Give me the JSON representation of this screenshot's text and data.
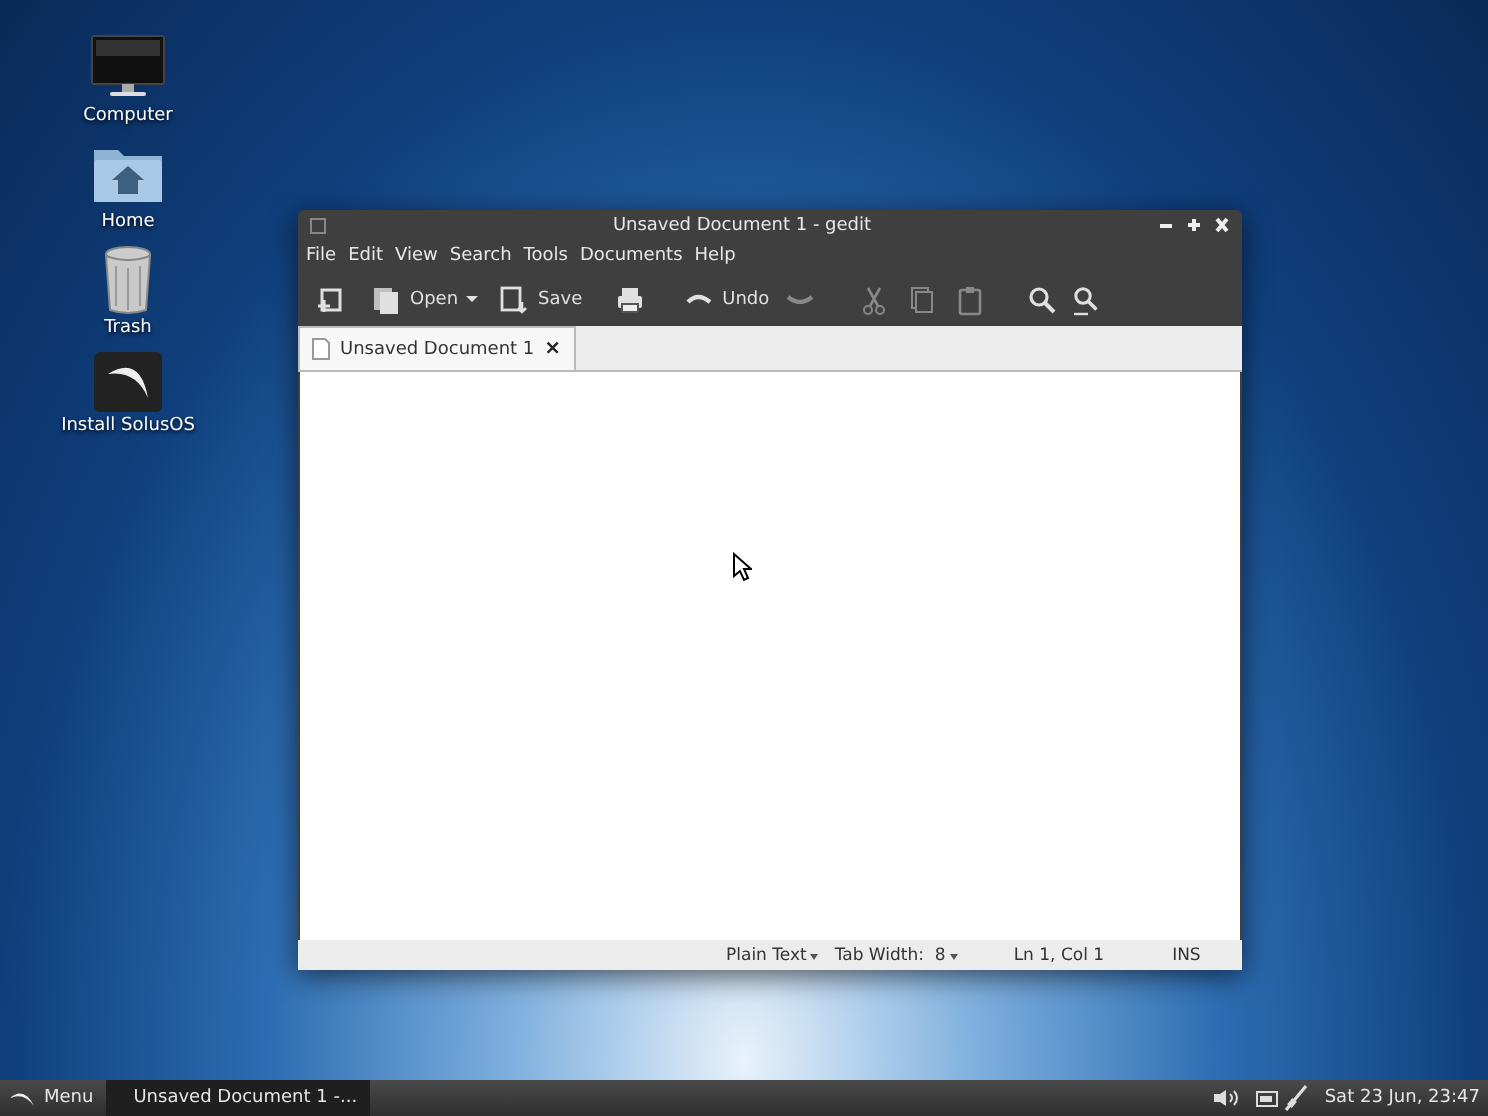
{
  "desktop_icons": [
    {
      "label": "Computer",
      "kind": "monitor"
    },
    {
      "label": "Home",
      "kind": "folder"
    },
    {
      "label": "Trash",
      "kind": "trash"
    },
    {
      "label": "Install SolusOS",
      "kind": "installer"
    }
  ],
  "window": {
    "title": "Unsaved Document 1 - gedit",
    "menu": [
      "File",
      "Edit",
      "View",
      "Search",
      "Tools",
      "Documents",
      "Help"
    ],
    "toolbar": [
      {
        "kind": "new",
        "disabled": false
      },
      {
        "kind": "open",
        "label": "Open",
        "disabled": false
      },
      {
        "kind": "dropdown",
        "disabled": false
      },
      {
        "kind": "save",
        "label": "Save",
        "disabled": false
      },
      {
        "kind": "print",
        "disabled": false
      },
      {
        "kind": "undo",
        "label": "Undo",
        "disabled": false
      },
      {
        "kind": "redo",
        "disabled": true
      },
      {
        "kind": "cut",
        "disabled": true
      },
      {
        "kind": "copy",
        "disabled": true
      },
      {
        "kind": "paste",
        "disabled": true
      },
      {
        "kind": "find",
        "disabled": false
      },
      {
        "kind": "replace",
        "disabled": false
      }
    ],
    "tabs": [
      {
        "label": "Unsaved Document 1",
        "selected": true,
        "close": "×"
      }
    ],
    "status_bar": {
      "language": "Plain Text",
      "tab_width": "Tab Width:  8",
      "position": "Ln 1, Col 1",
      "mode": "INS"
    }
  },
  "taskbar": {
    "menu_button": "Menu",
    "tasks": [
      {
        "label": "Unsaved Document 1 -...",
        "selected": true
      }
    ],
    "clock": "Sat 23 Jun, 23:47"
  }
}
